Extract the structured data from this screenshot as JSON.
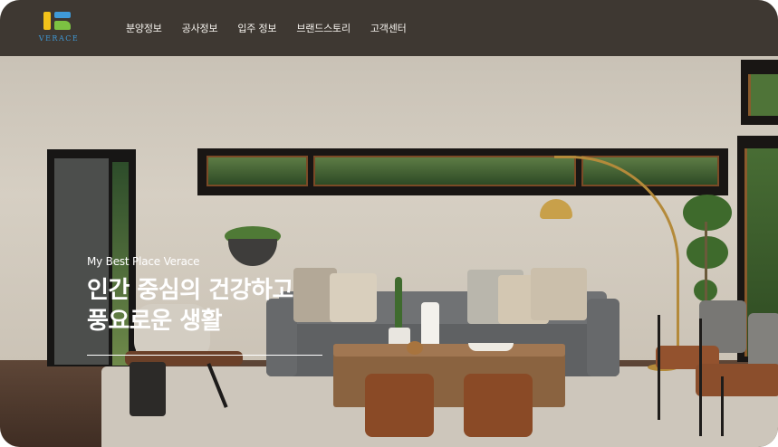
{
  "header": {
    "logo_text": "VERACE",
    "nav": [
      {
        "label": "분양정보"
      },
      {
        "label": "공사정보"
      },
      {
        "label": "입주 정보"
      },
      {
        "label": "브랜드스토리"
      },
      {
        "label": "고객센터"
      }
    ]
  },
  "hero": {
    "tagline": "My Best Place Verace",
    "title": "인간 중심의 건강하고\n풍요로운 생활"
  },
  "colors": {
    "header_bg": "#3e3832",
    "logo_blue": "#3f9ad8",
    "logo_yellow": "#f2c21a",
    "logo_green": "#7cc242",
    "hero_text": "#ffffff"
  }
}
